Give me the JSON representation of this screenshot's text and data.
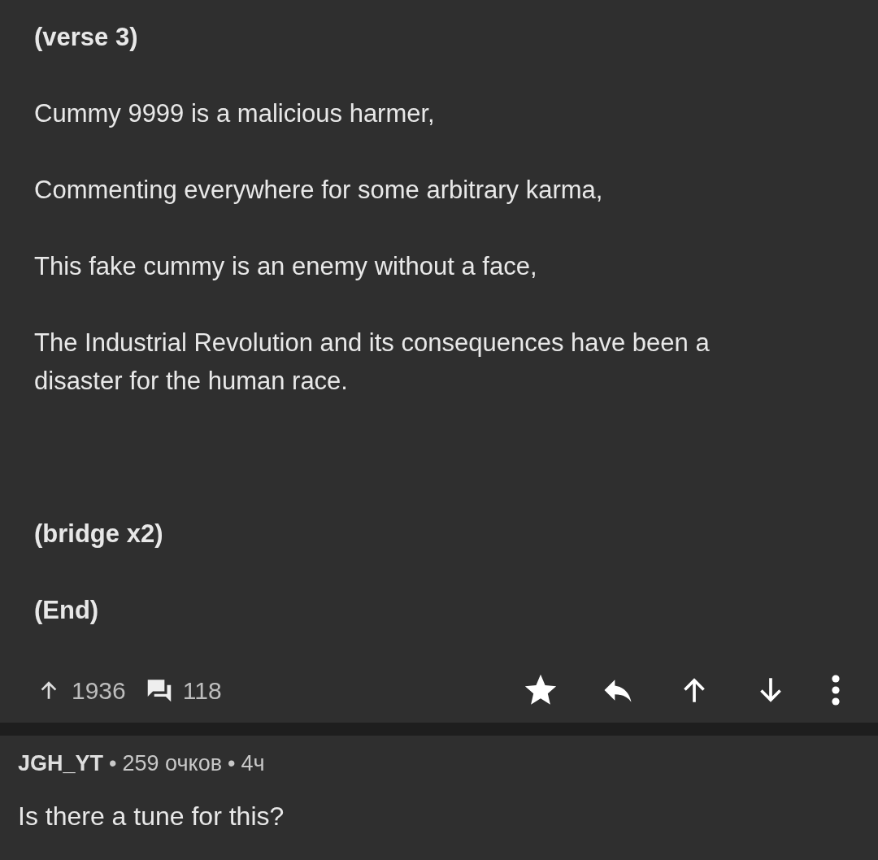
{
  "post": {
    "paragraphs": [
      {
        "kind": "heading",
        "text": "(verse 3)"
      },
      {
        "kind": "text",
        "text": "Cummy 9999 is a malicious harmer,"
      },
      {
        "kind": "text",
        "text": "Commenting everywhere for some arbitrary karma,"
      },
      {
        "kind": "text",
        "text": "This fake cummy is an enemy without a face,"
      },
      {
        "kind": "text",
        "text": "The Industrial Revolution and its consequences have been a disaster for the human race."
      },
      {
        "kind": "heading",
        "text": "(bridge x2)"
      },
      {
        "kind": "heading",
        "text": "(End)"
      }
    ],
    "score": "1936",
    "comments": "118"
  },
  "comment": {
    "author": "JGH_YT",
    "separators": [
      "•",
      "•"
    ],
    "points": "259 очков",
    "age": "4ч",
    "text": "Is there a tune for this?"
  }
}
